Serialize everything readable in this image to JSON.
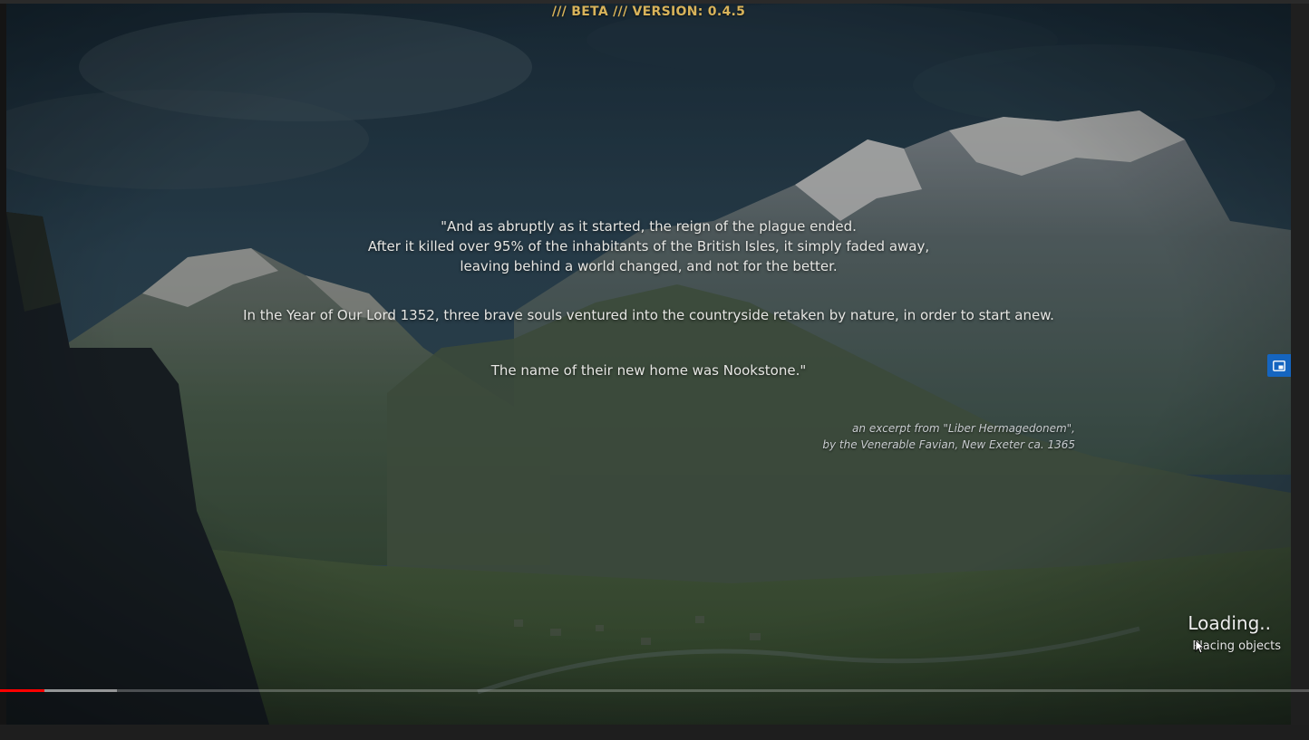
{
  "version_banner": "/// BETA /// VERSION:  0.4.5",
  "quote": {
    "lines": [
      "\"And as abruptly as it started, the reign of the plague ended.",
      "After it killed over 95% of the inhabitants of the British Isles, it simply faded away,",
      "leaving behind a world changed, and not for the better.",
      "In the Year of Our Lord 1352, three brave souls ventured into the countryside retaken by nature, in order to start anew.",
      "The name of their new home was Nookstone.\""
    ],
    "attribution": [
      "an excerpt from \"Liber Hermagedonem\",",
      "by the Venerable Favian, New Exeter ca. 1365"
    ]
  },
  "loading": {
    "title": "Loading..",
    "status": "Placing objects"
  },
  "side_button": {
    "icon": "picture-in-picture-icon"
  },
  "video_progress": {
    "played_fraction": 0.034,
    "buffered_fraction": 0.055
  },
  "colors": {
    "version_text": "#d8b35a",
    "side_button": "#1565c0",
    "progress_played": "#ff0000"
  }
}
